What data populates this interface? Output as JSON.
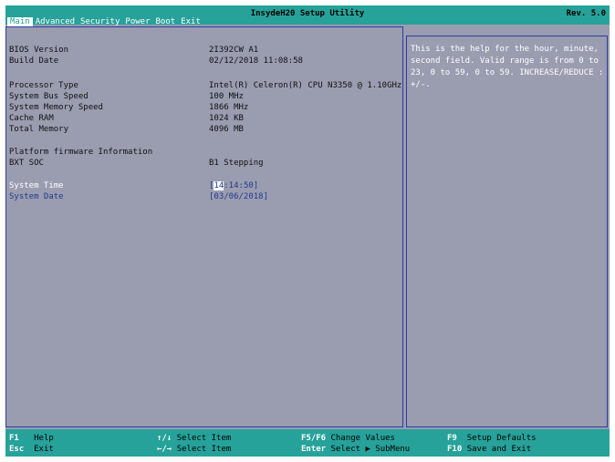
{
  "window": {
    "title": "InsydeH20 Setup Utility",
    "revision": "Rev. 5.0"
  },
  "menu": {
    "tabs": [
      "Main",
      "Advanced",
      "Security",
      "Power",
      "Boot",
      "Exit"
    ],
    "active_index": 0
  },
  "main": {
    "rows": [
      {
        "label": "BIOS Version",
        "value": "2I392CW A1"
      },
      {
        "label": "Build Date",
        "value": "02/12/2018 11:08:58"
      },
      {
        "label": "Processor Type",
        "value": "Intel(R) Celeron(R) CPU N3350 @ 1.10GHz"
      },
      {
        "label": "System Bus Speed",
        "value": "100 MHz"
      },
      {
        "label": "System Memory Speed",
        "value": "1866 MHz"
      },
      {
        "label": "Cache RAM",
        "value": "1024 KB"
      },
      {
        "label": "Total Memory",
        "value": "4096 MB"
      },
      {
        "label": "BXT SOC",
        "value": "B1 Stepping"
      }
    ],
    "section_header": "Platform firmware Information",
    "system_time": {
      "label": "System Time",
      "open": "[",
      "cursor": "14",
      "rest": ":14:50]"
    },
    "system_date": {
      "label": "System Date",
      "value": "[03/06/2018]"
    }
  },
  "help": {
    "text": "This is the help for the hour, minute, second field. Valid range is from 0 to 23, 0 to 59, 0 to 59. INCREASE/REDUCE : +/-."
  },
  "footer": {
    "keys": [
      {
        "key": "F1",
        "desc": "Help"
      },
      {
        "key": "Esc",
        "desc": "Exit"
      },
      {
        "key": "↑/↓",
        "desc": "Select Item"
      },
      {
        "key": "←/→",
        "desc": "Select Item"
      },
      {
        "key": "F5/F6",
        "desc": "Change Values"
      },
      {
        "key": "Enter",
        "desc": "Select ▶ SubMenu"
      },
      {
        "key": "F9",
        "desc": "Setup Defaults"
      },
      {
        "key": "F10",
        "desc": "Save and Exit"
      }
    ]
  },
  "colors": {
    "bar": "#26a29a",
    "panel": "#9a9cb0",
    "border": "#2f3aa0",
    "field_text": "#1f3c8a"
  }
}
